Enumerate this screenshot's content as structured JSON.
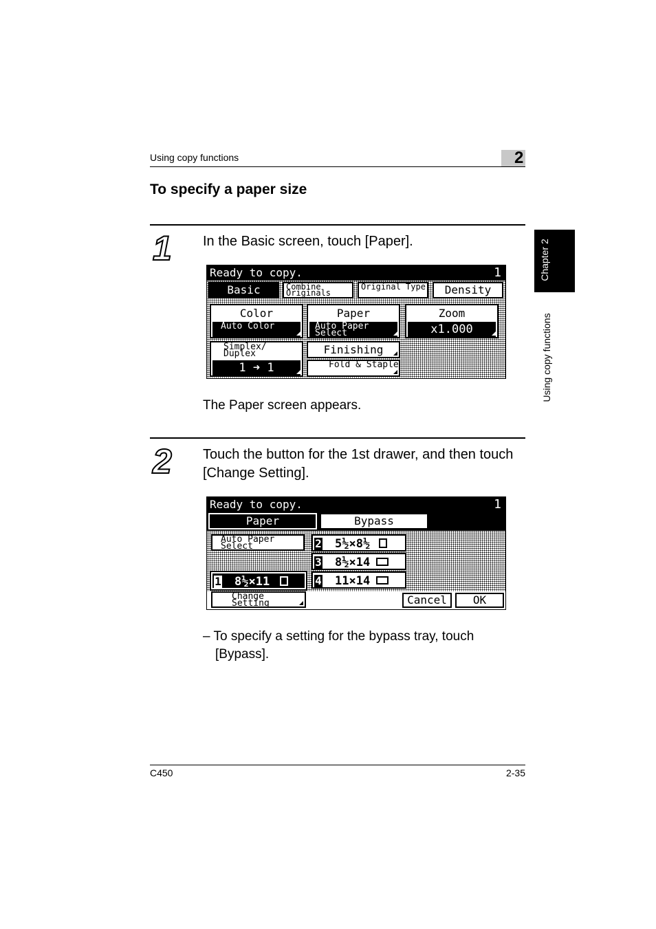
{
  "header": {
    "section": "Using copy functions",
    "chapter_number": "2"
  },
  "title": "To specify a paper size",
  "side_tab": {
    "chapter": "Chapter 2",
    "section": "Using copy functions"
  },
  "steps": [
    {
      "number": "1",
      "text": "In the Basic screen, touch [Paper].",
      "result": "The Paper screen appears."
    },
    {
      "number": "2",
      "text": "Touch the button for the 1st drawer, and then touch [Change Setting].",
      "note": "– To specify a setting for the bypass tray, touch [Bypass]."
    }
  ],
  "screen_basic": {
    "status": "Ready to copy.",
    "page": "1",
    "tabs": [
      "Basic",
      "Combine Originals",
      "Original Type",
      "Density"
    ],
    "color": {
      "label": "Color",
      "value": "Auto Color"
    },
    "paper": {
      "label": "Paper",
      "value": "Auto Paper Select"
    },
    "zoom": {
      "label": "Zoom",
      "value": "x1.000"
    },
    "simplex": {
      "label": "Simplex/ Duplex",
      "value": "1 ➜ 1"
    },
    "finishing": "Finishing",
    "fold": "Fold & Staple"
  },
  "screen_paper": {
    "status": "Ready to copy.",
    "page": "1",
    "tabs": [
      "Paper",
      "Bypass"
    ],
    "auto_paper": "Auto Paper Select",
    "change_setting": "Change Setting",
    "cancel": "Cancel",
    "ok": "OK",
    "trays": [
      {
        "number": "1",
        "size": "8½×11"
      },
      {
        "number": "2",
        "size": "5½×8½"
      },
      {
        "number": "3",
        "size": "8½×14"
      },
      {
        "number": "4",
        "size": "11×14"
      }
    ]
  },
  "footer": {
    "model": "C450",
    "page": "2-35"
  }
}
